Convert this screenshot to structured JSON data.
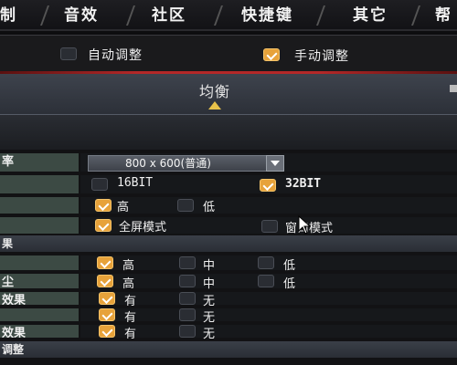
{
  "top_tabs": [
    "制",
    "音效",
    "社区",
    "快捷键",
    "其它",
    "帮"
  ],
  "mode": {
    "auto_label": "自动调整",
    "auto_checked": false,
    "manual_label": "手动调整",
    "manual_checked": true
  },
  "preset": {
    "label": "均衡"
  },
  "settings": {
    "resolution": {
      "label": "率",
      "value": "800 x 600(普通)"
    },
    "color_depth": {
      "label": "",
      "opt1": "16BIT",
      "opt1_checked": false,
      "opt2": "32BIT",
      "opt2_checked": true
    },
    "quality": {
      "label": "",
      "opt1": "高",
      "opt1_checked": true,
      "opt2": "低",
      "opt2_checked": false
    },
    "display_mode": {
      "label": "",
      "opt1": "全屏模式",
      "opt1_checked": true,
      "opt2": "窗口模式",
      "opt2_checked": false
    },
    "section1": "果",
    "rows": [
      {
        "label": "",
        "a": "高",
        "a_checked": true,
        "b": "中",
        "b_checked": false,
        "c": "低",
        "c_checked": false
      },
      {
        "label": "尘",
        "a": "高",
        "a_checked": true,
        "b": "中",
        "b_checked": false,
        "c": "低",
        "c_checked": false
      },
      {
        "label": "效果",
        "a": "有",
        "a_checked": true,
        "b": "无",
        "b_checked": false
      },
      {
        "label": "",
        "a": "有",
        "a_checked": true,
        "b": "无",
        "b_checked": false
      },
      {
        "label": "效果",
        "a": "有",
        "a_checked": true,
        "b": "无",
        "b_checked": false
      }
    ],
    "section2": "调整"
  },
  "colors": {
    "accent": "#e7a23a",
    "label_bg": "#3c4a44",
    "red_line": "#b42828"
  }
}
